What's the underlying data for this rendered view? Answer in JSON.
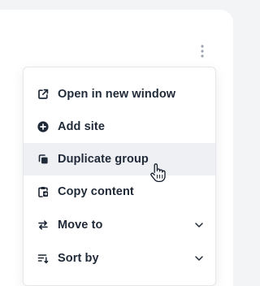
{
  "menu": {
    "items": [
      {
        "label": "Open in new window",
        "icon": "external-link-icon"
      },
      {
        "label": "Add site",
        "icon": "plus-circle-icon"
      },
      {
        "label": "Duplicate group",
        "icon": "duplicate-icon",
        "state": "hovered"
      },
      {
        "label": "Copy content",
        "icon": "clipboard-icon"
      },
      {
        "label": "Move to",
        "icon": "arrows-swap-icon",
        "submenu": "chevron-down-icon"
      },
      {
        "label": "Sort by",
        "icon": "sort-icon",
        "submenu": "chevron-down-icon"
      }
    ]
  },
  "colors": {
    "page_background": "#f3f4f6",
    "card": "#ffffff",
    "hover_row": "#eef0f4",
    "text": "#1f2937",
    "icon": "#1f2937",
    "kebab": "#9ca3af"
  }
}
